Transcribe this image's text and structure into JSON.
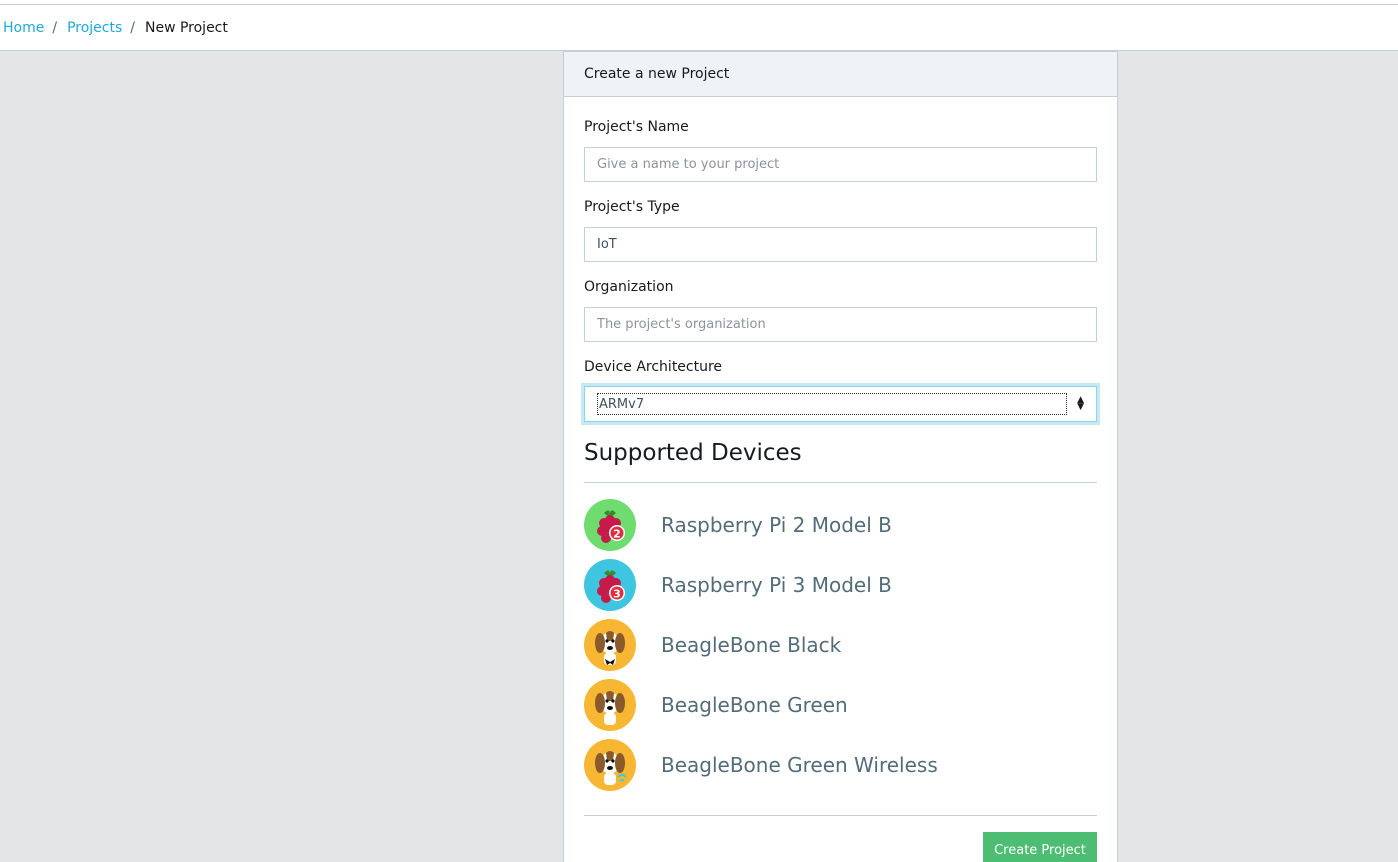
{
  "breadcrumb": {
    "home": "Home",
    "projects": "Projects",
    "separator": "/",
    "current": "New Project"
  },
  "card": {
    "header": "Create a new Project"
  },
  "form": {
    "name_label": "Project's Name",
    "name_placeholder": "Give a name to your project",
    "type_label": "Project's Type",
    "type_value": "IoT",
    "org_label": "Organization",
    "org_placeholder": "The project's organization",
    "arch_label": "Device Architecture",
    "arch_value": "ARMv7"
  },
  "devices": {
    "title": "Supported Devices",
    "items": [
      {
        "name": "Raspberry Pi 2 Model B",
        "icon": "raspberry-pi-2-icon",
        "badge": "2",
        "bg": "#6fdc6f"
      },
      {
        "name": "Raspberry Pi 3 Model B",
        "icon": "raspberry-pi-3-icon",
        "badge": "3",
        "bg": "#3ec6e0"
      },
      {
        "name": "BeagleBone Black",
        "icon": "beaglebone-black-icon",
        "bg": "#f7b733"
      },
      {
        "name": "BeagleBone Green",
        "icon": "beaglebone-green-icon",
        "bg": "#f7b733"
      },
      {
        "name": "BeagleBone Green Wireless",
        "icon": "beaglebone-green-wireless-icon",
        "bg": "#f7b733"
      }
    ]
  },
  "actions": {
    "create_label": "Create Project"
  },
  "colors": {
    "link": "#20a8d8",
    "success": "#4dbd74",
    "background": "#e4e5e6"
  }
}
